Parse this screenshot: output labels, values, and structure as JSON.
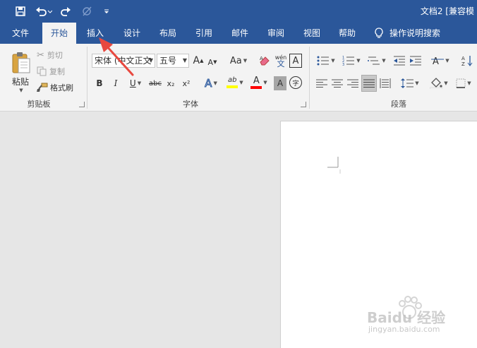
{
  "title_bar": {
    "document_title": "文档2 [兼容模"
  },
  "quick_access": {
    "save": "save-icon",
    "undo": "undo-icon",
    "redo": "redo-icon",
    "touch": "touch-mode-icon",
    "customize": "customize-icon"
  },
  "tabs": [
    {
      "label": "文件"
    },
    {
      "label": "开始"
    },
    {
      "label": "插入"
    },
    {
      "label": "设计"
    },
    {
      "label": "布局"
    },
    {
      "label": "引用"
    },
    {
      "label": "邮件"
    },
    {
      "label": "审阅"
    },
    {
      "label": "视图"
    },
    {
      "label": "帮助"
    }
  ],
  "tell_me": {
    "label": "操作说明搜索",
    "icon": "lightbulb-icon"
  },
  "clipboard": {
    "group_label": "剪贴板",
    "paste": "粘贴",
    "cut": "剪切",
    "copy": "复制",
    "format_painter": "格式刷"
  },
  "font": {
    "group_label": "字体",
    "font_name": "宋体 (中文正文",
    "font_size": "五号",
    "change_case": "Aa",
    "bold": "B",
    "italic": "I",
    "underline": "U",
    "strikethrough": "abc",
    "subscript": "x₂",
    "superscript": "x²",
    "text_effect": "A",
    "highlight": "ab",
    "font_color": "A",
    "char_shading": "A",
    "enclose": "字",
    "phonetic_top": "wén",
    "phonetic_bottom": "文",
    "char_border": "A",
    "grow": "A",
    "shrink": "A"
  },
  "paragraph": {
    "group_label": "段落"
  },
  "colors": {
    "brand": "#2b579a",
    "highlight": "#ffff00",
    "font_color": "#ff0000",
    "arrow": "#e8483f"
  },
  "watermark": {
    "line1": "Baidu 经验",
    "line2": "jingyan.baidu.com"
  }
}
